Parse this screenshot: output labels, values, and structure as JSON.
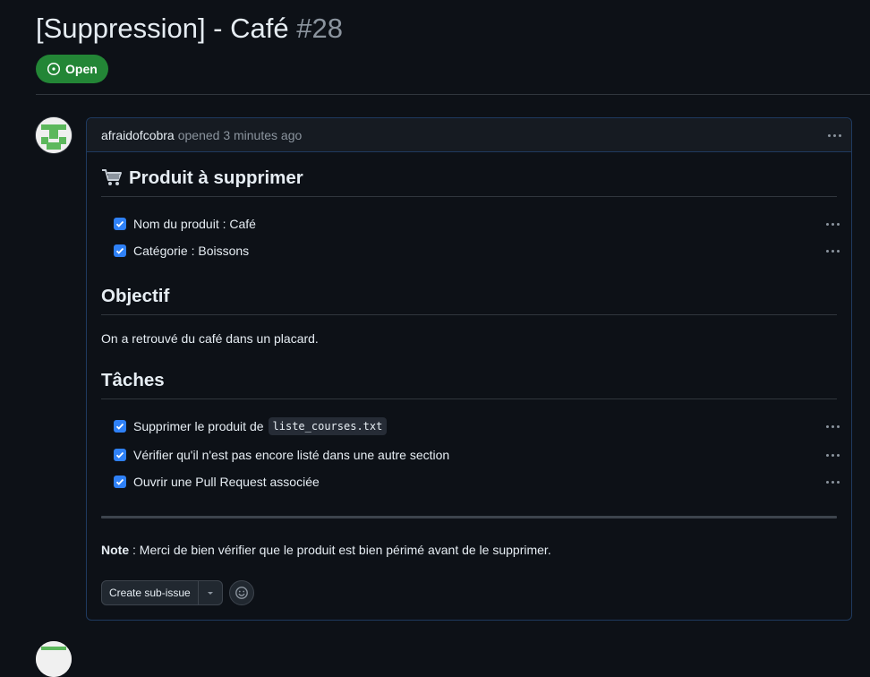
{
  "issue": {
    "title": "[Suppression] - Café",
    "number": "#28",
    "state_label": "Open"
  },
  "comment": {
    "author": "afraidofcobra",
    "meta": "opened 3 minutes ago",
    "section1": {
      "emoji": "🛒",
      "heading": "Produit à supprimer",
      "tasks": [
        {
          "label": "Nom du produit : Café",
          "checked": true
        },
        {
          "label": "Catégorie : Boissons",
          "checked": true
        }
      ]
    },
    "section2": {
      "heading": "Objectif",
      "text": "On a retrouvé du café dans un placard."
    },
    "section3": {
      "heading": "Tâches",
      "tasks": [
        {
          "label": "Supprimer le produit de",
          "code": "liste_courses.txt",
          "checked": true
        },
        {
          "label": "Vérifier qu'il n'est pas encore listé dans une autre section",
          "checked": true
        },
        {
          "label": "Ouvrir une Pull Request associée",
          "checked": true
        }
      ]
    },
    "note": {
      "label": "Note",
      "text": " : Merci de bien vérifier que le produit est bien périmé avant de le supprimer."
    },
    "create_sub_issue_label": "Create sub-issue"
  },
  "colors": {
    "background": "#0d1117",
    "open_badge": "#238636",
    "checkbox": "#2f81f7",
    "comment_border": "#1f3a5f"
  },
  "icons": {
    "state": "issue-opened-icon",
    "menu": "kebab-horizontal-icon",
    "reaction": "smiley-icon",
    "caret": "triangle-down-icon"
  }
}
